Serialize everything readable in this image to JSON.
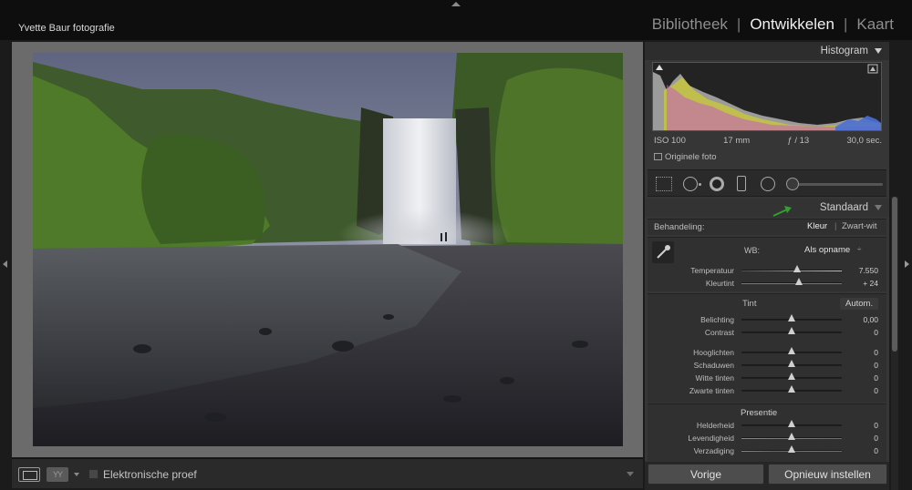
{
  "identity_plate": "Yvette Baur fotografie",
  "modules": [
    {
      "label": "Bibliotheek",
      "active": false
    },
    {
      "label": "Ontwikkelen",
      "active": true
    },
    {
      "label": "Kaart",
      "active": false
    }
  ],
  "module_separator": "|",
  "toolbar": {
    "view_icon": "loupe-view-icon",
    "compare_icon": "before-after-icon",
    "compare_label": "YY",
    "softproof_label": "Elektronische proef",
    "softproof_checked": false
  },
  "histogram": {
    "title": "Histogram",
    "iso": "ISO 100",
    "focal": "17 mm",
    "aperture": "ƒ / 13",
    "shutter": "30,0 sec.",
    "original_label": "Originele foto"
  },
  "basic": {
    "profile_label": "Standaard",
    "treatment_label": "Behandeling:",
    "treatment_color": "Kleur",
    "treatment_separator": "|",
    "treatment_bw": "Zwart-wit",
    "wb_label": "WB:",
    "wb_value": "Als opname",
    "wb_arrows": "÷",
    "wb_sliders": [
      {
        "label": "Temperatuur",
        "value": "7.550",
        "position": 0.55
      },
      {
        "label": "Kleurtint",
        "value": "+ 24",
        "position": 0.57
      }
    ],
    "tone_title": "Tint",
    "auto_label": "Autom.",
    "tone_sliders": [
      {
        "label": "Belichting",
        "value": "0,00",
        "position": 0.5
      },
      {
        "label": "Contrast",
        "value": "0",
        "position": 0.5
      },
      {
        "label": "Hooglichten",
        "value": "0",
        "position": 0.5
      },
      {
        "label": "Schaduwen",
        "value": "0",
        "position": 0.5
      },
      {
        "label": "Witte tinten",
        "value": "0",
        "position": 0.5
      },
      {
        "label": "Zwarte tinten",
        "value": "0",
        "position": 0.5
      }
    ],
    "presence_title": "Presentie",
    "presence_sliders": [
      {
        "label": "Helderheid",
        "value": "0",
        "position": 0.5
      },
      {
        "label": "Levendigheid",
        "value": "0",
        "position": 0.5
      },
      {
        "label": "Verzadiging",
        "value": "0",
        "position": 0.5
      }
    ]
  },
  "footer": {
    "previous_label": "Vorige",
    "reset_label": "Opnieuw instellen"
  },
  "colors": {
    "accent_arrow": "#2fa12f",
    "panel_bg": "#363636",
    "preview_bg": "#6b6b6b"
  }
}
